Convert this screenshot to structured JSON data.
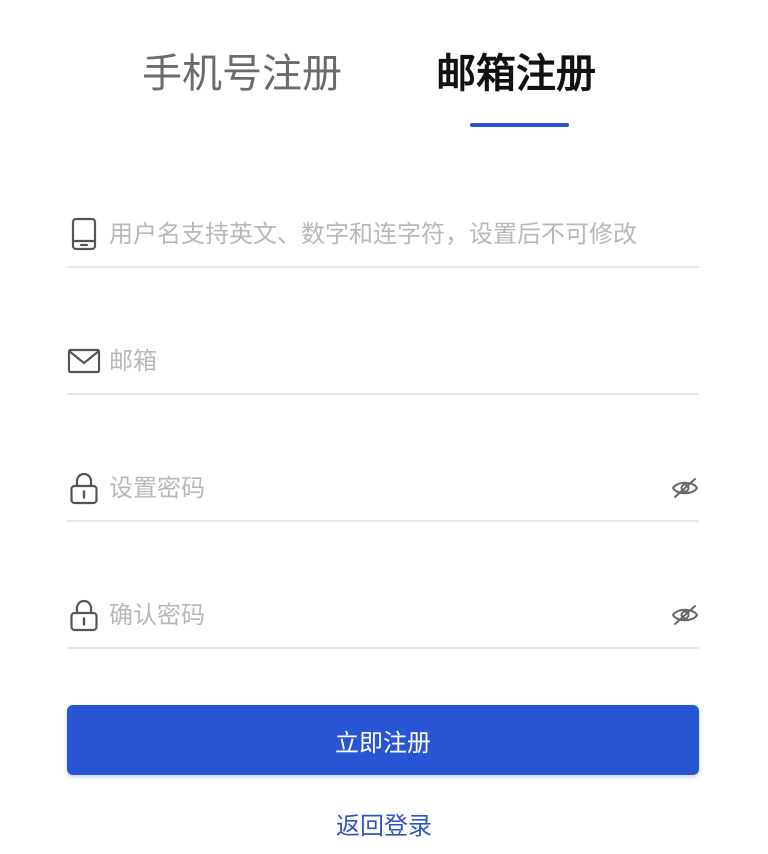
{
  "tabs": {
    "phone_label": "手机号注册",
    "email_label": "邮箱注册",
    "active": "email"
  },
  "form": {
    "username": {
      "icon": "tablet-icon",
      "value": "",
      "placeholder": "用户名支持英文、数字和连字符，设置后不可修改"
    },
    "email": {
      "icon": "mail-icon",
      "value": "",
      "placeholder": "邮箱"
    },
    "password": {
      "icon": "lock-icon",
      "value": "",
      "placeholder": "设置密码",
      "toggle_icon": "eye-off-icon"
    },
    "confirm_password": {
      "icon": "lock-icon",
      "value": "",
      "placeholder": "确认密码",
      "toggle_icon": "eye-off-icon"
    }
  },
  "submit_label": "立即注册",
  "back_link_label": "返回登录",
  "colors": {
    "accent": "#2855d3",
    "link": "#2f55c0",
    "placeholder": "#b8b8b8",
    "divider": "#e6e6e6",
    "inactive_tab": "#6b6b6b",
    "active_tab": "#111111"
  }
}
